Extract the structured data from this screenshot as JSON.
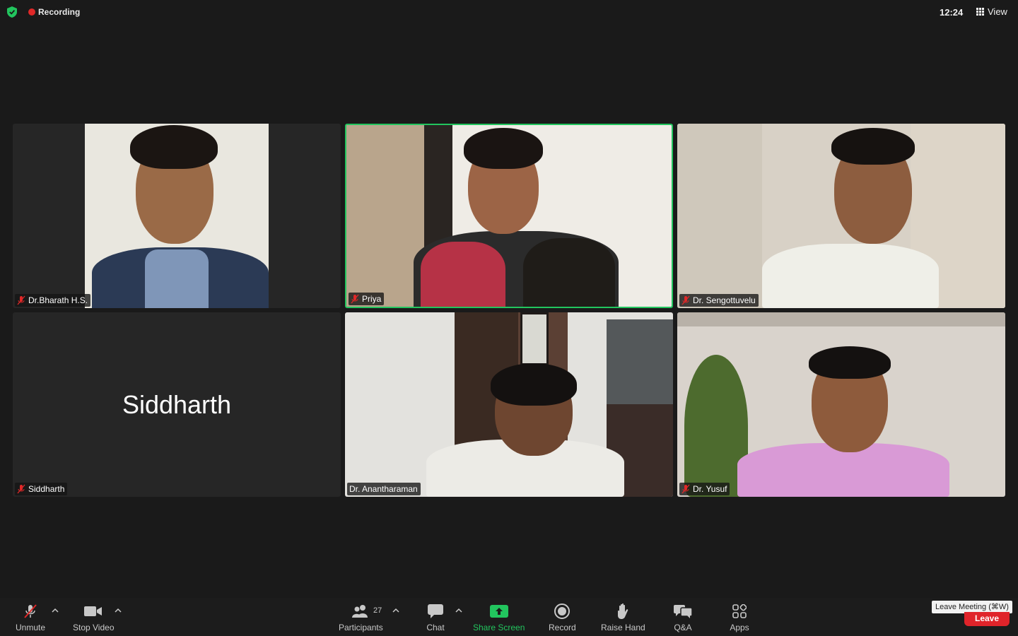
{
  "topbar": {
    "recording_label": "Recording",
    "clock": "12:24",
    "view_label": "View"
  },
  "tiles": [
    {
      "name": "Dr.Bharath H.S.",
      "muted": true,
      "video": true
    },
    {
      "name": "Priya",
      "muted": true,
      "video": true,
      "active_speaker": true
    },
    {
      "name": "Dr. Sengottuvelu",
      "muted": true,
      "video": true
    },
    {
      "name": "Siddharth",
      "muted": true,
      "video": false,
      "display_name": "Siddharth"
    },
    {
      "name": "Dr. Anantharaman",
      "muted": false,
      "video": true
    },
    {
      "name": "Dr. Yusuf",
      "muted": true,
      "video": true
    }
  ],
  "toolbar": {
    "unmute_label": "Unmute",
    "stop_video_label": "Stop Video",
    "participants_label": "Participants",
    "participants_count": "27",
    "chat_label": "Chat",
    "share_screen_label": "Share Screen",
    "record_label": "Record",
    "raise_hand_label": "Raise Hand",
    "qa_label": "Q&A",
    "apps_label": "Apps",
    "leave_tooltip": "Leave Meeting (⌘W)",
    "leave_label": "Leave"
  },
  "colors": {
    "active_speaker_border": "#22c55e",
    "share_screen": "#22c55e",
    "leave_button": "#e0242a",
    "recording_dot": "#e02828"
  }
}
